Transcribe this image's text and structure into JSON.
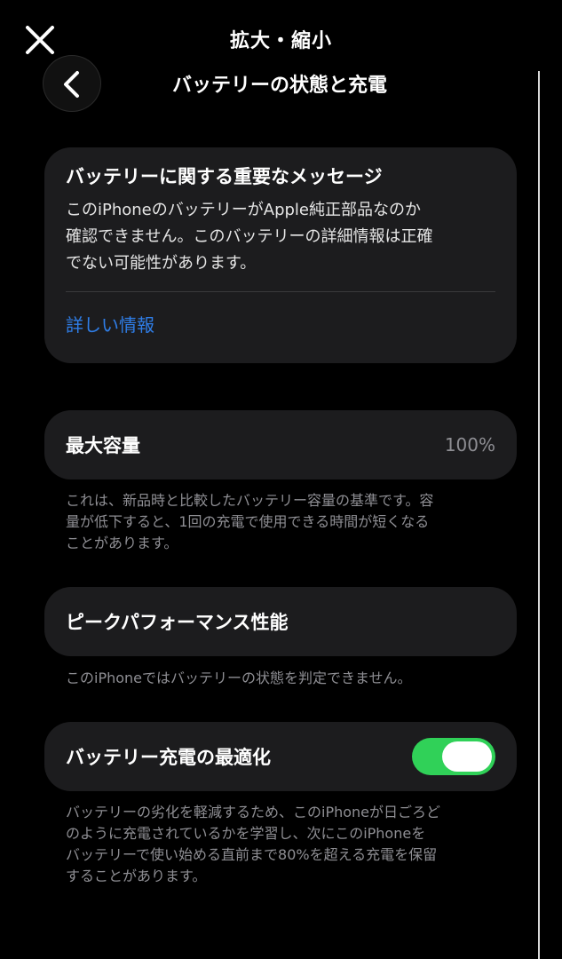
{
  "colors": {
    "background": "#000000",
    "card": "#1c1c1e",
    "link": "#2f7ee8",
    "secondary_text": "#8e8e93",
    "toggle_on": "#30d158"
  },
  "topbar": {
    "close_icon": "close-icon",
    "title": "拡大・縮小"
  },
  "nav": {
    "back_icon": "chevron-left-icon",
    "title": "バッテリーの状態と充電"
  },
  "message": {
    "title": "バッテリーに関する重要なメッセージ",
    "line1": "このiPhoneのバッテリーがApple純正部品なのか",
    "line2": "確認できません。このバッテリーの詳細情報は正確",
    "line3": "でない可能性があります。",
    "link": "詳しい情報"
  },
  "capacity": {
    "label": "最大容量",
    "value": "100%",
    "footnote_line1": "これは、新品時と比較したバッテリー容量の基準です。容",
    "footnote_line2": "量が低下すると、1回の充電で使用できる時間が短くなる",
    "footnote_line3": "ことがあります。"
  },
  "peak": {
    "label": "ピークパフォーマンス性能",
    "footnote": "このiPhoneではバッテリーの状態を判定できません。"
  },
  "optimized": {
    "label": "バッテリー充電の最適化",
    "toggle_on": true,
    "footnote_line1": "バッテリーの劣化を軽減するため、このiPhoneが日ごろど",
    "footnote_line2": "のように充電されているかを学習し、次にこのiPhoneを",
    "footnote_line3": "バッテリーで使い始める直前まで80%を超える充電を保留",
    "footnote_line4": "することがあります。"
  }
}
